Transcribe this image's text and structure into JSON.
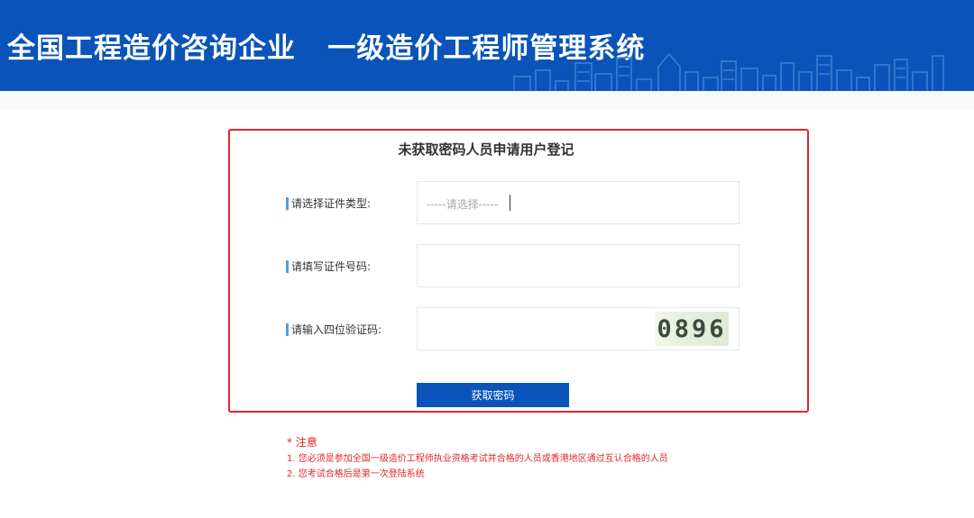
{
  "header": {
    "title": "全国工程造价咨询企业   一级造价工程师管理系统"
  },
  "form": {
    "title": "未获取密码人员申请用户登记",
    "rows": [
      {
        "label": "请选择证件类型:",
        "placeholder": "-----请选择-----"
      },
      {
        "label": "请填写证件号码:",
        "value": ""
      },
      {
        "label": "请输入四位验证码:",
        "captcha": "0896"
      }
    ],
    "submit_label": "获取密码"
  },
  "notice": {
    "heading": "* 注意",
    "items": [
      "1. 您必须是参加全国一级造价工程师执业资格考试并合格的人员或香港地区通过互认合格的人员",
      "2. 您考试合格后是第一次登陆系统"
    ]
  },
  "colors": {
    "header_bg": "#0a54b9",
    "border_red": "#e0262d",
    "button_bg": "#0a54b9",
    "notice_text": "#e0262d"
  }
}
